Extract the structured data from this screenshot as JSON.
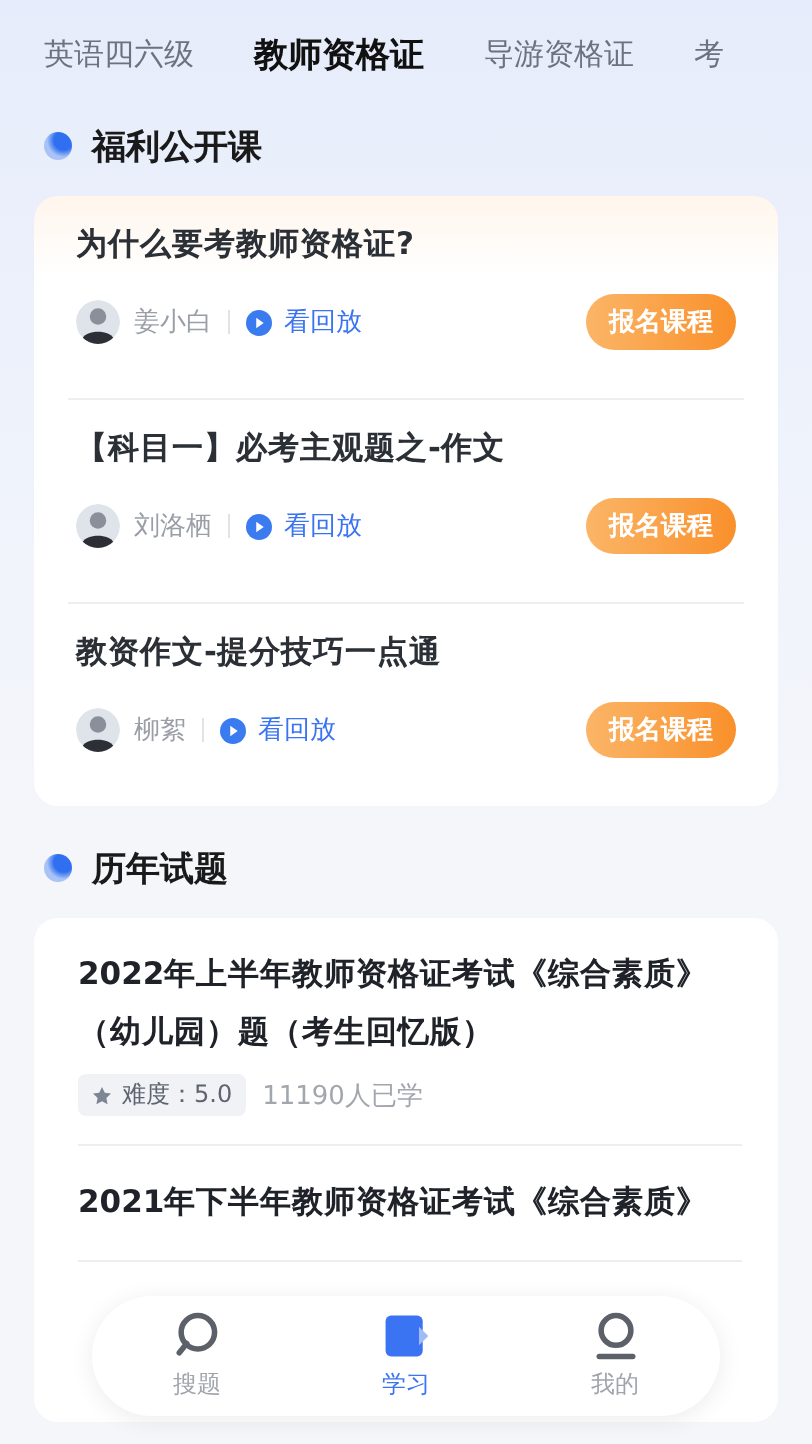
{
  "tabs": [
    {
      "label": "英语四六级",
      "selected": false
    },
    {
      "label": "教师资格证",
      "selected": true
    },
    {
      "label": "导游资格证",
      "selected": false
    },
    {
      "label": "考",
      "selected": false
    }
  ],
  "open_courses": {
    "title": "福利公开课",
    "items": [
      {
        "title": "为什么要考教师资格证?",
        "teacher": "姜小白",
        "replay": "看回放",
        "button": "报名课程"
      },
      {
        "title": "【科目一】必考主观题之-作文",
        "teacher": "刘洛栖",
        "replay": "看回放",
        "button": "报名课程"
      },
      {
        "title": "教资作文-提分技巧一点通",
        "teacher": "柳絮",
        "replay": "看回放",
        "button": "报名课程"
      }
    ]
  },
  "past_papers": {
    "title": "历年试题",
    "items": [
      {
        "title": "2022年上半年教师资格证考试《综合素质》（幼儿园）题（考生回忆版）",
        "difficulty": "难度：5.0",
        "learners": "11190人已学"
      },
      {
        "title": "2021年下半年教师资格证考试《综合素质》"
      }
    ]
  },
  "bottom_nav": [
    {
      "label": "搜题",
      "kind": "search",
      "selected": false
    },
    {
      "label": "学习",
      "kind": "study",
      "selected": true
    },
    {
      "label": "我的",
      "kind": "profile",
      "selected": false
    }
  ]
}
